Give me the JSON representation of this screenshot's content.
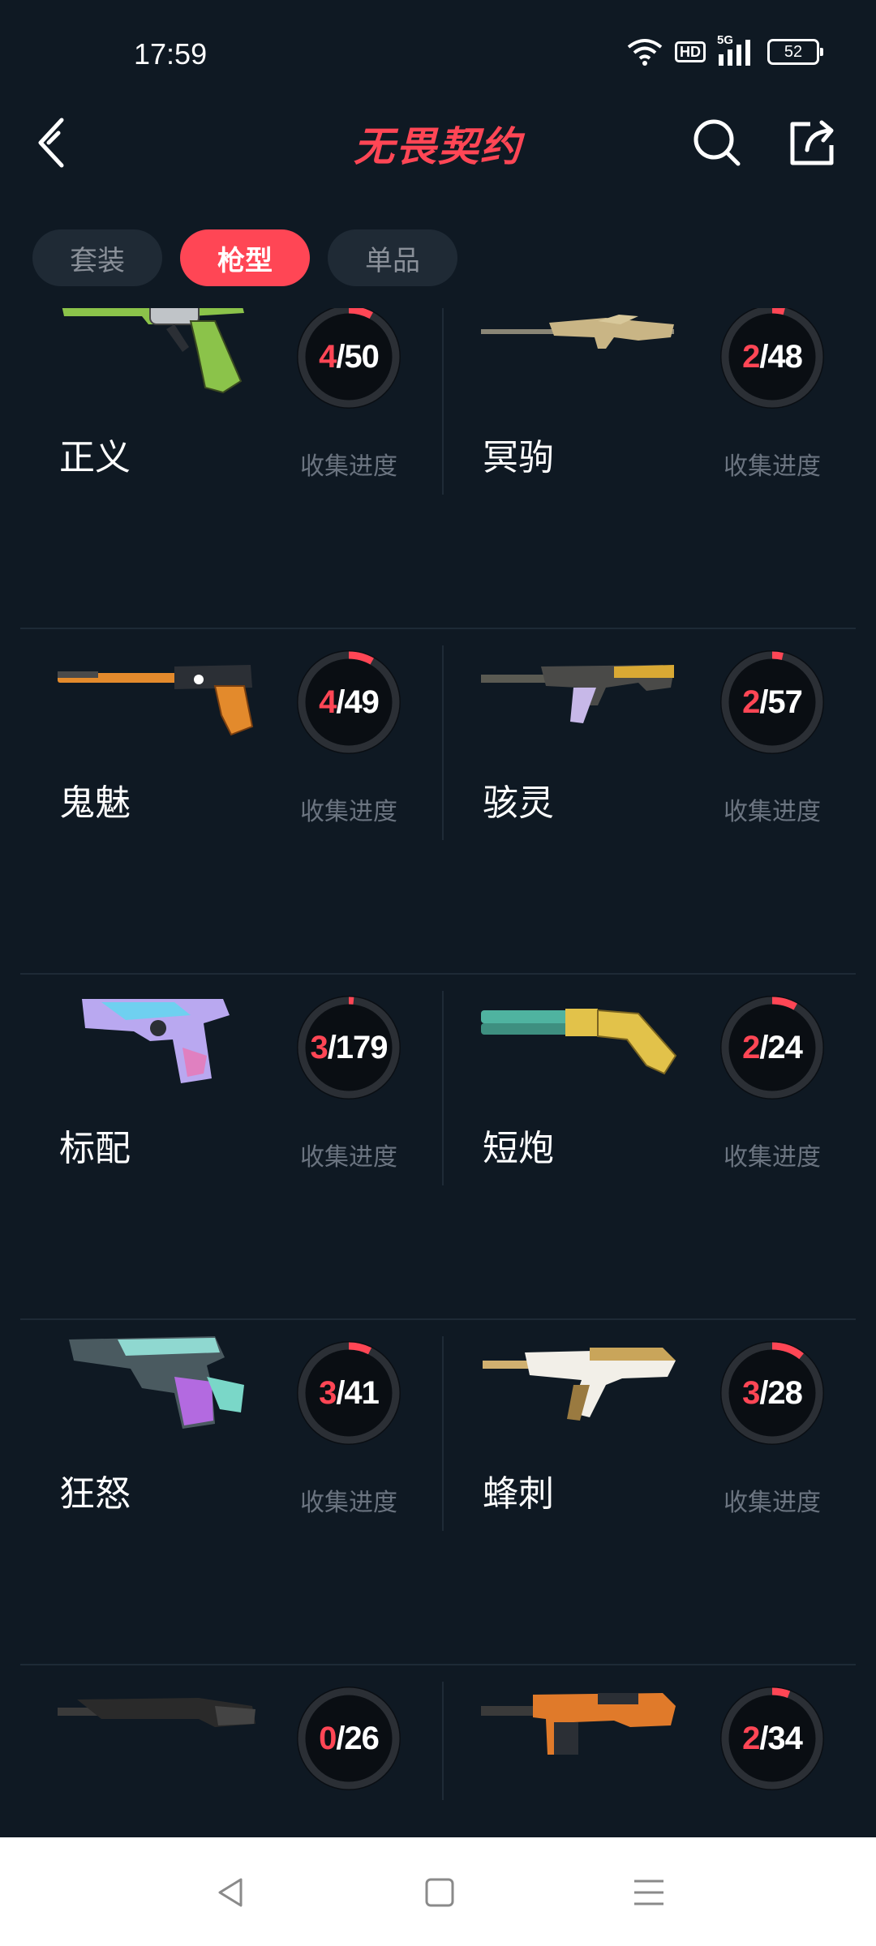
{
  "status_bar": {
    "time": "17:59",
    "hd": "HD",
    "network": "5G",
    "battery": "52"
  },
  "header": {
    "title": "无畏契约",
    "back_icon": "back-arrow-icon",
    "search_icon": "search-icon",
    "share_icon": "share-icon"
  },
  "tabs": [
    {
      "label": "套装",
      "active": false
    },
    {
      "label": "枪型",
      "active": true
    },
    {
      "label": "单品",
      "active": false
    }
  ],
  "progress_label": "收集进度",
  "colors": {
    "accent": "#ff4655",
    "background": "#0f1923",
    "ring_track": "#2b2f35"
  },
  "weapons": [
    {
      "name": "正义",
      "collected": "4",
      "total": "/50"
    },
    {
      "name": "冥驹",
      "collected": "2",
      "total": "/48"
    },
    {
      "name": "鬼魅",
      "collected": "4",
      "total": "/49"
    },
    {
      "name": "骇灵",
      "collected": "2",
      "total": "/57"
    },
    {
      "name": "标配",
      "collected": "3",
      "total": "/179"
    },
    {
      "name": "短炮",
      "collected": "2",
      "total": "/24"
    },
    {
      "name": "狂怒",
      "collected": "3",
      "total": "/41"
    },
    {
      "name": "蜂刺",
      "collected": "3",
      "total": "/28"
    },
    {
      "name": "",
      "collected": "0",
      "total": "/26"
    },
    {
      "name": "",
      "collected": "2",
      "total": "/34"
    }
  ],
  "nav": {
    "back": "nav-back-icon",
    "home": "nav-home-icon",
    "menu": "nav-menu-icon"
  }
}
